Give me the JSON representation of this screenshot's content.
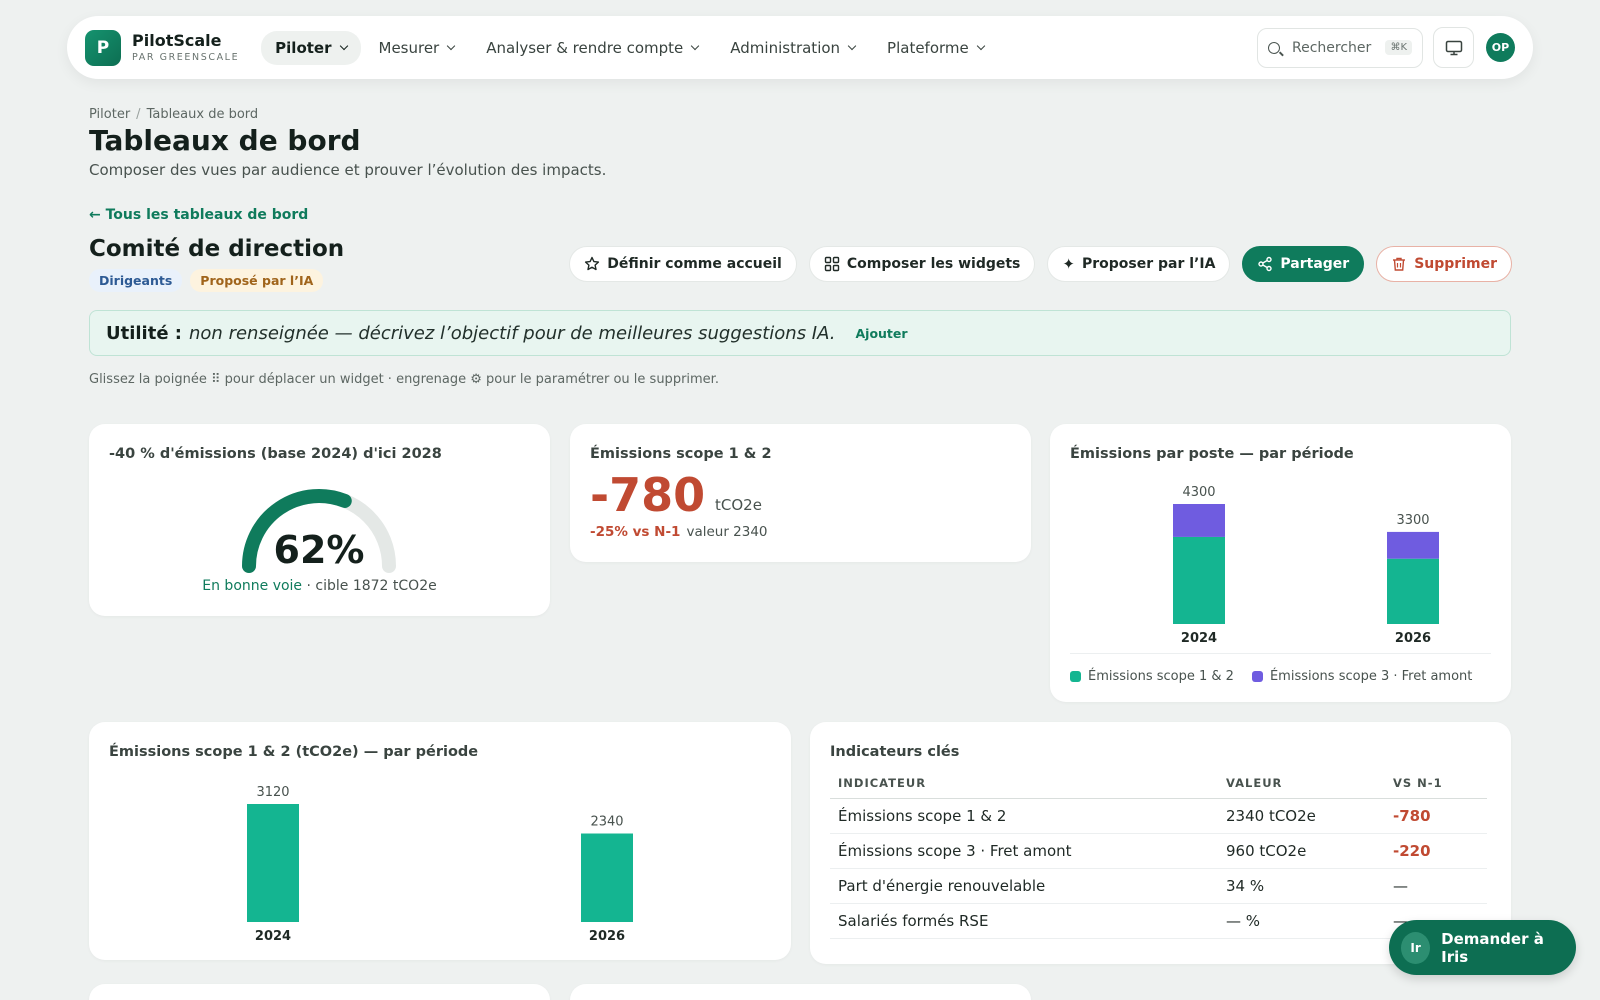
{
  "brand": {
    "name": "PilotScale",
    "sub": "PAR GREENSCALE",
    "logo_letter": "P"
  },
  "nav": {
    "items": [
      {
        "label": "Piloter",
        "active": true
      },
      {
        "label": "Mesurer"
      },
      {
        "label": "Analyser & rendre compte"
      },
      {
        "label": "Administration"
      },
      {
        "label": "Plateforme"
      }
    ],
    "search_label": "Rechercher",
    "search_shortcut": "⌘K",
    "avatar_initials": "OP"
  },
  "breadcrumb": {
    "parent": "Piloter",
    "current": "Tableaux de bord"
  },
  "page": {
    "title": "Tableaux de bord",
    "subtitle": "Composer des vues par audience et prouver l’évolution des impacts."
  },
  "dashboard": {
    "back_label": "← Tous les tableaux de bord",
    "title": "Comité de direction",
    "badges": {
      "audience": "Dirigeants",
      "origin": "Proposé par l’IA"
    }
  },
  "actions": {
    "home": "Définir comme accueil",
    "compose": "Composer les widgets",
    "ai": "Proposer par l’IA",
    "share": "Partager",
    "delete": "Supprimer"
  },
  "utility": {
    "label": "Utilité :",
    "text": "non renseignée — décrivez l’objectif pour de meilleures suggestions IA.",
    "add": "Ajouter"
  },
  "hint": "Glissez la poignée ⠿ pour déplacer un widget · engrenage ⚙ pour le paramétrer ou le supprimer.",
  "widgets": {
    "gauge": {
      "title": "-40 % d'émissions (base 2024) d'ici 2028",
      "value_label": "62%",
      "fraction": 0.62,
      "status": "En bonne voie",
      "target": " · cible 1872 tCO2e",
      "color": "#0f7b5c"
    },
    "kpi": {
      "title": "Émissions scope 1 & 2",
      "value": "-780",
      "unit": "tCO2e",
      "delta": "-25% vs N-1",
      "detail": "valeur 2340"
    },
    "table": {
      "title": "Indicateurs clés",
      "headers": [
        "INDICATEUR",
        "VALEUR",
        "VS N-1"
      ],
      "rows": [
        [
          "Émissions scope 1 & 2",
          "2340 tCO2e",
          "-780"
        ],
        [
          "Émissions scope 3 · Fret amont",
          "960 tCO2e",
          "-220"
        ],
        [
          "Part d'énergie renouvelable",
          "34 %",
          "—"
        ],
        [
          "Salariés formés RSE",
          "— %",
          "—"
        ]
      ]
    }
  },
  "chart_data": [
    {
      "type": "bar",
      "stacked": true,
      "title": "Émissions par poste — par période",
      "categories": [
        "2024",
        "2026"
      ],
      "totals": [
        4300,
        3300
      ],
      "series": [
        {
          "name": "Émissions scope 1 & 2",
          "values": [
            3120,
            2340
          ],
          "color": "#14b591"
        },
        {
          "name": "Émissions scope 3 · Fret amont",
          "values": [
            1180,
            960
          ],
          "color": "#6f5ce0"
        }
      ],
      "ylim": [
        0,
        4300
      ],
      "legend": "bottom"
    },
    {
      "type": "bar",
      "title": "Émissions scope 1 & 2 (tCO2e) — par période",
      "categories": [
        "2024",
        "2026"
      ],
      "values": [
        3120,
        2340
      ],
      "color": "#14b591",
      "ylim": [
        0,
        3120
      ]
    }
  ],
  "iris": {
    "avatar": "Ir",
    "label": "Demander à Iris"
  }
}
